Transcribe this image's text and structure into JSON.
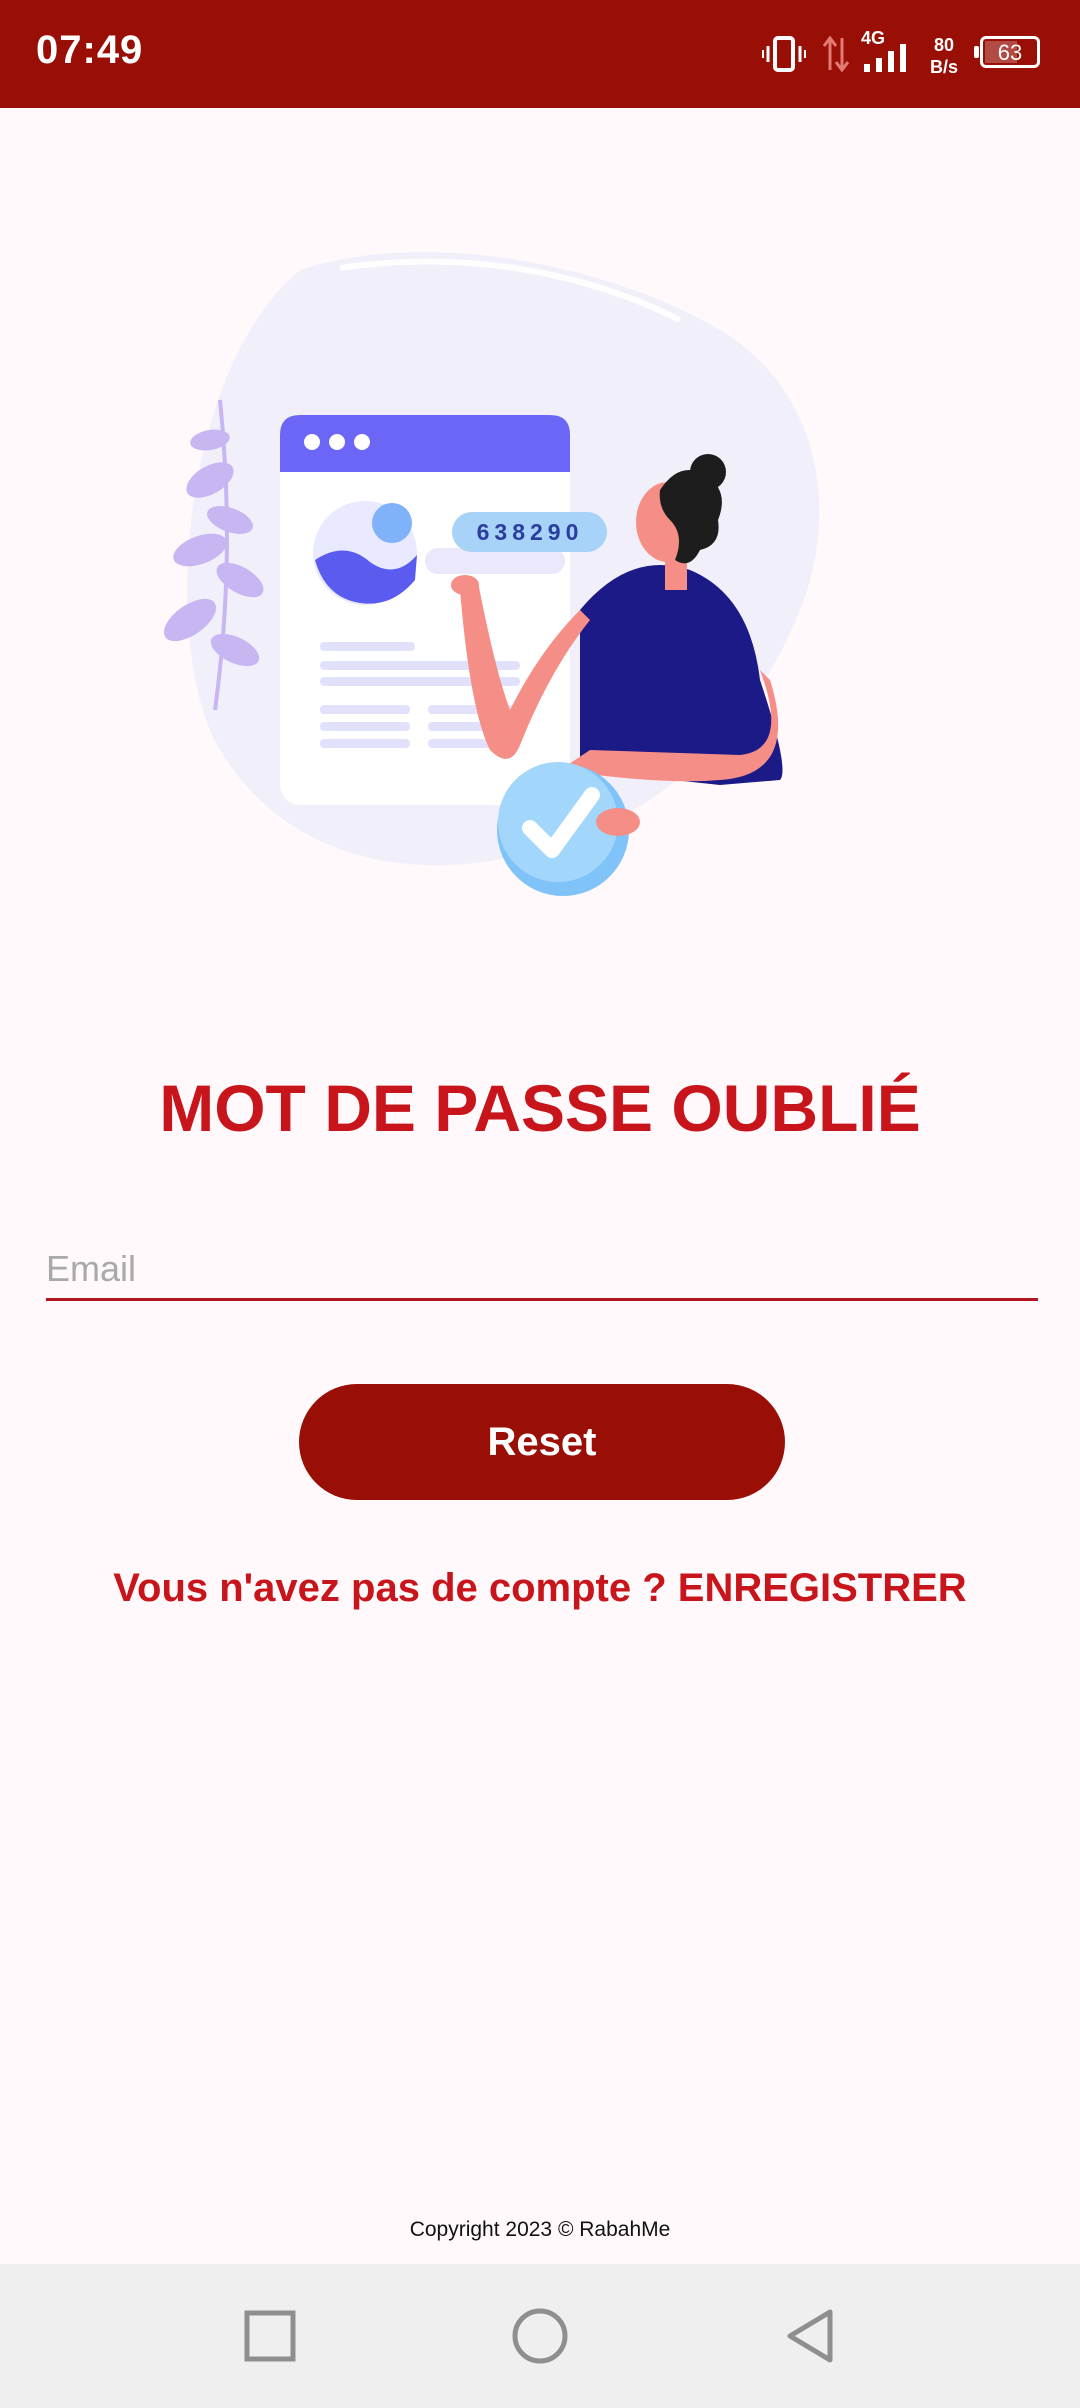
{
  "status_bar": {
    "time": "07:49",
    "network_type": "4G",
    "net_speed_value": "80",
    "net_speed_unit": "B/s",
    "battery_level": "63",
    "icons": [
      "vibrate-icon",
      "data-transfer-icon",
      "signal-icon",
      "battery-icon"
    ]
  },
  "illustration": {
    "code_text": "638290",
    "description_icons": [
      "browser-window-icon",
      "person-icon",
      "checkmark-icon",
      "plant-icon"
    ]
  },
  "page": {
    "title": "MOT DE PASSE OUBLIÉ",
    "email_placeholder": "Email",
    "email_value": "",
    "reset_label": "Reset",
    "register_text": "Vous n'avez pas de compte ? ENREGISTRER",
    "copyright": "Copyright 2023 © RabahMe"
  },
  "colors": {
    "primary_dark": "#990f06",
    "accent_red": "#c8141b",
    "background": "#fff9fb",
    "nav_bar": "#efefef"
  },
  "nav_bar": {
    "buttons": [
      "recents-square-icon",
      "home-circle-icon",
      "back-triangle-icon"
    ]
  }
}
